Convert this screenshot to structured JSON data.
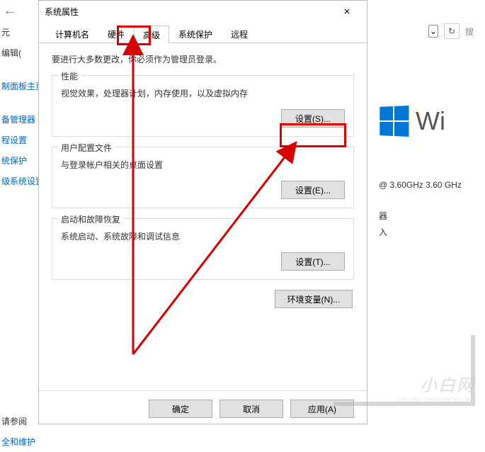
{
  "dialog": {
    "title": "系统属性",
    "close": "×",
    "tabs": {
      "computer_name": "计算机名",
      "hardware": "硬件",
      "advanced": "高级",
      "system_protection": "系统保护",
      "remote": "远程"
    },
    "intro": "要进行大多数更改，你必须作为管理员登录。",
    "performance": {
      "title": "性能",
      "desc": "视觉效果，处理器计划，内存使用，以及虚拟内存",
      "button": "设置(S)..."
    },
    "user_profile": {
      "title": "用户配置文件",
      "desc": "与登录帐户相关的桌面设置",
      "button": "设置(E)..."
    },
    "startup": {
      "title": "启动和故障恢复",
      "desc": "系统启动、系统故障和调试信息",
      "button": "设置(T)..."
    },
    "env_button": "环境变量(N)...",
    "ok": "确定",
    "cancel": "取消",
    "apply": "应用(A)"
  },
  "background": {
    "back_arrow": "←",
    "unit": "元",
    "edit": "编辑(",
    "panel_home": "制面板主页",
    "device_mgr": "备管理器",
    "remote_set": "程设置",
    "sys_protect": "统保护",
    "adv_sys": "级系统设置",
    "see_also": "请参阅",
    "sec_maint": "全和维护",
    "dropdown_arrow": "⌄",
    "refresh": "↻",
    "search": "搜",
    "win_text": "Wi",
    "cpu": "@ 3.60GHz   3.60 GHz",
    "misc1": "器",
    "misc2": "入"
  },
  "watermark": "小白网"
}
